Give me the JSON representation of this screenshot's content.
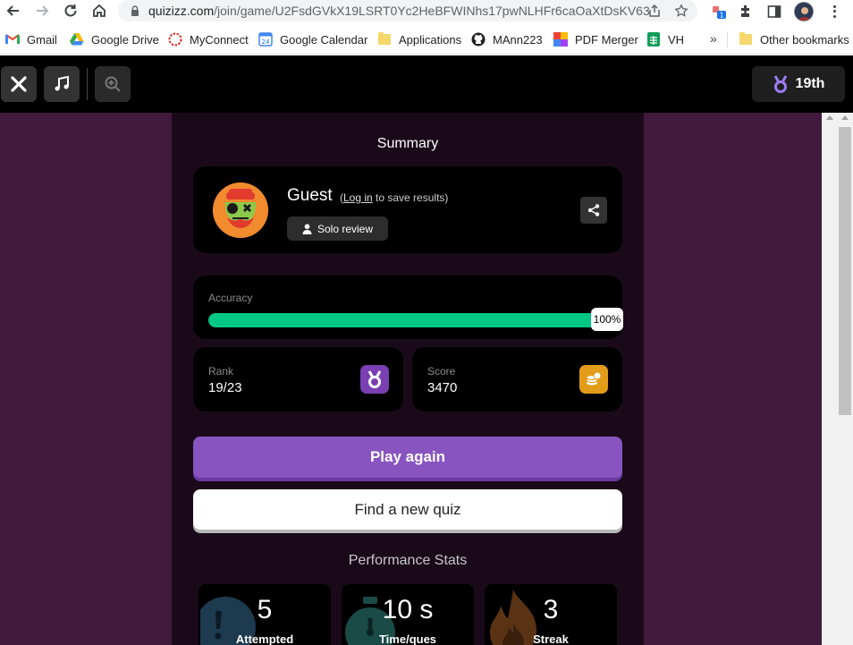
{
  "browser": {
    "url_host": "quizizz.com",
    "url_path": "/join/game/U2FsdGVkX19LSRT0Yc2HeBFWINhs17pwNLHFr6caOaXtDsKV63...",
    "ext_badge": "1",
    "bookmarks": [
      {
        "label": "Gmail",
        "icon": "gmail-icon"
      },
      {
        "label": "Google Drive",
        "icon": "drive-icon"
      },
      {
        "label": "MyConnect",
        "icon": "myconnect-icon"
      },
      {
        "label": "Google Calendar",
        "icon": "calendar-icon"
      },
      {
        "label": "Applications",
        "icon": "folder-icon"
      },
      {
        "label": "MAnn223",
        "icon": "github-icon"
      },
      {
        "label": "PDF Merger",
        "icon": "pdf-merger-icon"
      },
      {
        "label": "VH",
        "icon": "sheets-icon"
      }
    ],
    "other_bookmarks": "Other bookmarks",
    "overflow": "»"
  },
  "topbar": {
    "rank_label": "19th"
  },
  "summary": {
    "title": "Summary",
    "player_name": "Guest",
    "login_prefix": "(",
    "login_link": "Log in",
    "login_suffix": " to save results)",
    "mode_label": "Solo review",
    "accuracy_label": "Accuracy",
    "accuracy_percent": 100,
    "accuracy_text": "100%",
    "rank_label": "Rank",
    "rank_value": "19/23",
    "score_label": "Score",
    "score_value": "3470"
  },
  "actions": {
    "play_again": "Play again",
    "find_quiz": "Find a new quiz"
  },
  "performance": {
    "title": "Performance Stats",
    "stats": [
      {
        "value": "5",
        "label": "Attempted"
      },
      {
        "value": "10 s",
        "label": "Time/ques"
      },
      {
        "value": "3",
        "label": "Streak"
      }
    ]
  },
  "colors": {
    "accent_purple": "#8854c0",
    "accuracy_green": "#00c985",
    "page_bg": "#421a3d",
    "score_gold": "#e39c17"
  }
}
